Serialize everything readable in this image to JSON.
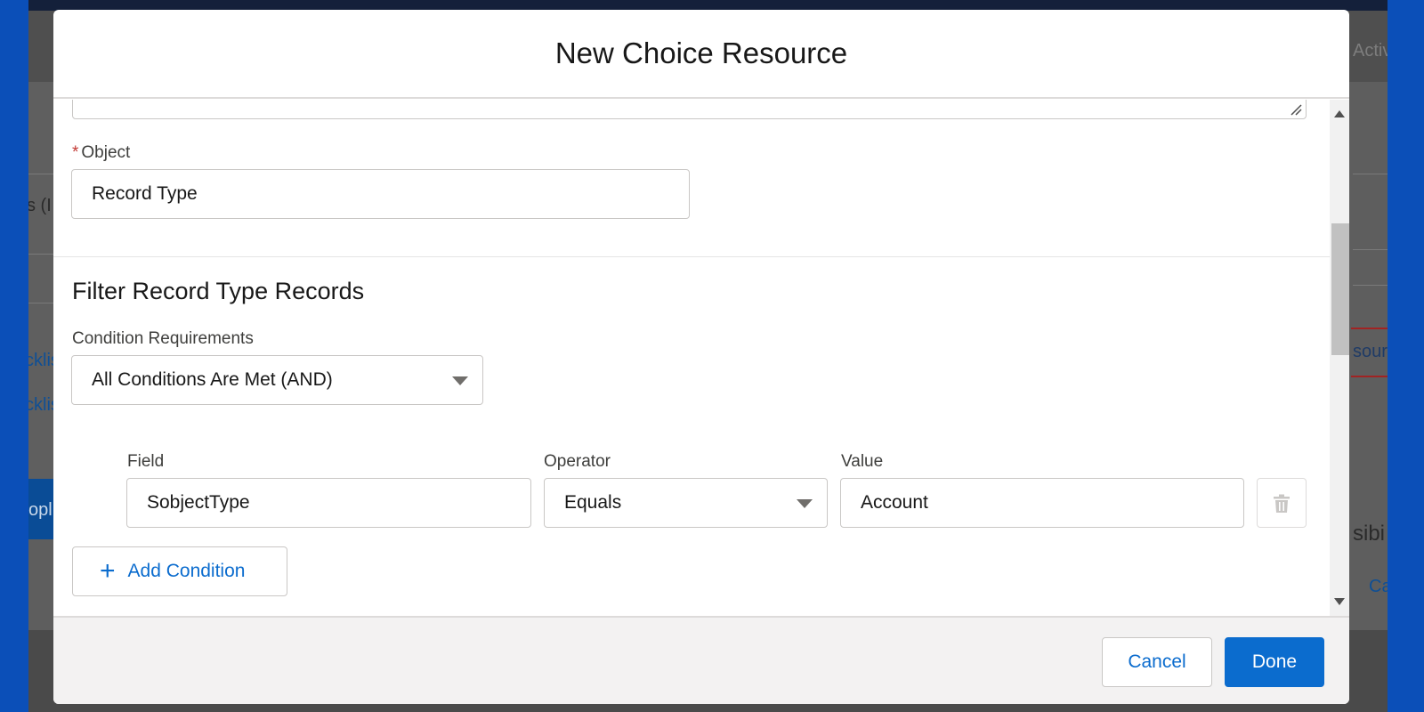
{
  "background": {
    "activity_text": "Activ",
    "left_text": "s (I",
    "left_links": [
      "cklist",
      "cklis"
    ],
    "left_button": "opl",
    "right_resource": "sourc",
    "right_visibility": "sibi",
    "right_link": "Ca"
  },
  "modal": {
    "title": "New Choice Resource",
    "object_field": {
      "required_marker": "*",
      "label": "Object",
      "value": "Record Type"
    },
    "filter_section": {
      "title": "Filter Record Type Records",
      "condition_requirements": {
        "label": "Condition Requirements",
        "value": "All Conditions Are Met (AND)"
      },
      "condition": {
        "field_label": "Field",
        "field_value": "SobjectType",
        "operator_label": "Operator",
        "operator_value": "Equals",
        "value_label": "Value",
        "value_value": "Account"
      },
      "add_condition_label": "Add Condition"
    },
    "footer": {
      "cancel_label": "Cancel",
      "done_label": "Done"
    }
  },
  "colors": {
    "brand_blue": "#0b6cce",
    "required_red": "#c23934",
    "frame_blue": "#0b4fb8"
  },
  "icons": {
    "trash": "trash-icon",
    "plus": "plus-icon",
    "caret": "chevron-down-icon",
    "resize": "resize-handle-icon"
  }
}
